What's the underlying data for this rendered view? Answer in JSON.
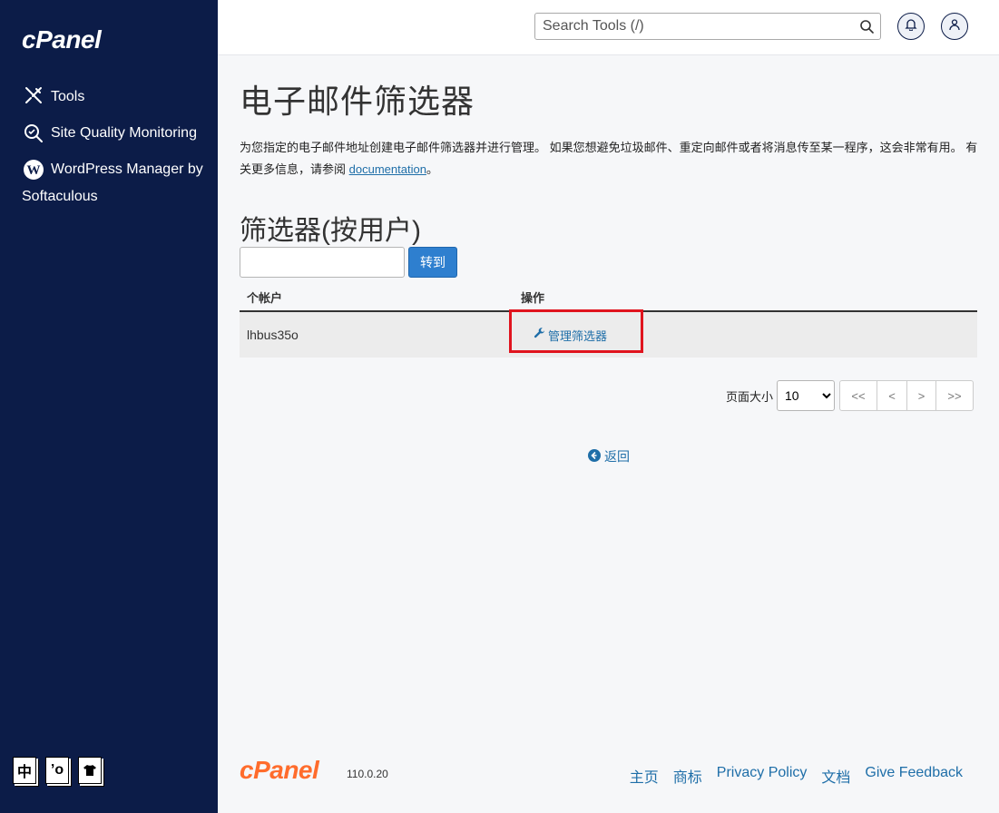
{
  "sidebar": {
    "brand": "cPanel",
    "items": [
      {
        "label": "Tools",
        "icon": "tools-icon"
      },
      {
        "label": "Site Quality Monitoring",
        "icon": "site-quality-icon"
      },
      {
        "label": "WordPress Manager by Softaculous",
        "icon": "wordpress-icon"
      }
    ],
    "lang_icons": [
      "中",
      "’o",
      "👕"
    ]
  },
  "topbar": {
    "search_placeholder": "Search Tools (/)"
  },
  "main": {
    "title": "电子邮件筛选器",
    "description": "为您指定的电子邮件地址创建电子邮件筛选器并进行管理。 如果您想避免垃圾邮件、重定向邮件或者将消息传至某一程序，这会非常有用。 有关更多信息，请参阅",
    "doc_link": "documentation",
    "doc_suffix": "。",
    "section_title": "筛选器(按用户)",
    "go_button": "转到",
    "table": {
      "headers": [
        "个帐户",
        "操作"
      ],
      "rows": [
        {
          "account": "lhbus35o",
          "action": "管理筛选器"
        }
      ]
    },
    "pager": {
      "page_size_label": "页面大小",
      "page_size": "10",
      "buttons": [
        "<<",
        "<",
        ">",
        ">>"
      ]
    },
    "back_link": "返回"
  },
  "footer": {
    "brand": "cPanel",
    "version": "110.0.20",
    "links": [
      "主页",
      "商标",
      "Privacy Policy",
      "文档",
      "Give Feedback"
    ]
  },
  "colors": {
    "sidebar_bg": "#0c1c48",
    "link": "#1e6ea8",
    "primary_button": "#2e7fcf",
    "highlight": "#e0141e",
    "footer_brand": "#ff6c2c"
  }
}
